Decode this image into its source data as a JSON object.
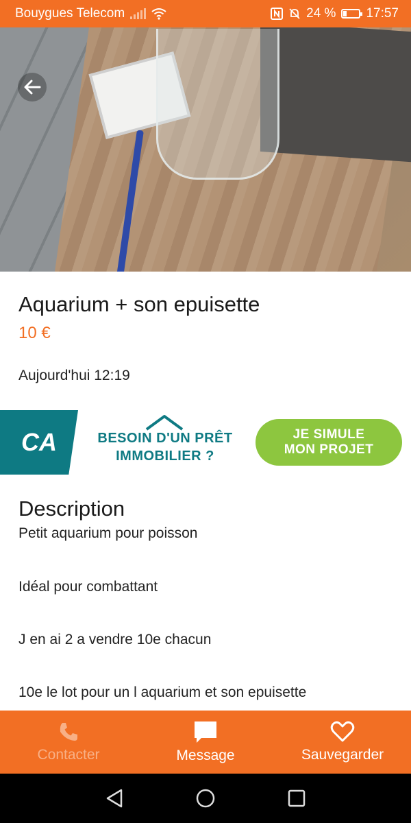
{
  "status_bar": {
    "carrier": "Bouygues Telecom",
    "battery": "24 %",
    "battery_level": 0.24,
    "time": "17:57",
    "icons": [
      "signal-icon",
      "wifi-icon",
      "nfc-icon",
      "mute-icon",
      "battery-icon"
    ]
  },
  "hero": {
    "image_count": 4,
    "active_index": 0,
    "back_icon": "arrow-left-icon"
  },
  "listing": {
    "title": "Aquarium + son epuisette",
    "price": "10 €",
    "date": "Aujourd'hui 12:19"
  },
  "ad": {
    "logo_text": "CA",
    "line1": "BESOIN D'UN PRÊT",
    "line2": "IMMOBILIER ?",
    "cta_line1": "JE SIMULE",
    "cta_line2": "MON PROJET",
    "colors": {
      "teal": "#0e7a83",
      "green": "#8dc63f"
    }
  },
  "description": {
    "heading": "Description",
    "lines": [
      "Petit aquarium pour poisson",
      "Idéal pour combattant",
      "J en ai 2 a vendre 10e chacun",
      "10e  le lot pour un l aquarium et son epuisette"
    ]
  },
  "actions": {
    "contact": {
      "label": "Contacter",
      "icon": "phone-icon",
      "enabled": false
    },
    "message": {
      "label": "Message",
      "icon": "chat-bubble-icon",
      "enabled": true
    },
    "save": {
      "label": "Sauvegarder",
      "icon": "heart-icon",
      "enabled": true
    }
  },
  "navigation": {
    "buttons": [
      "back-triangle-icon",
      "home-circle-icon",
      "recents-square-icon"
    ]
  },
  "colors": {
    "brand_orange": "#f26f24"
  }
}
